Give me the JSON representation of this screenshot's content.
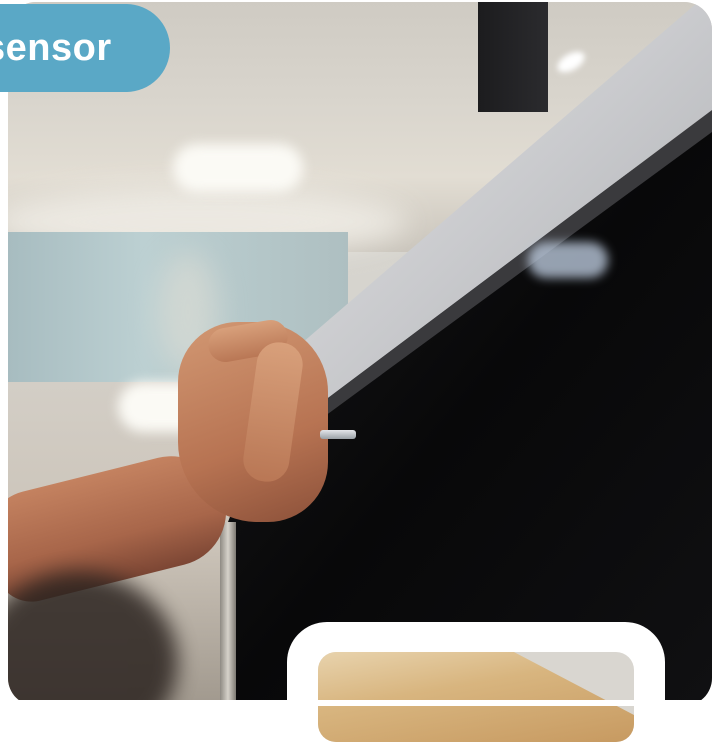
{
  "label": {
    "text": "sensor",
    "color": "#5aa8c6",
    "text_color": "#ffffff"
  },
  "photo": {
    "subject": "hand-opening-cabinet-door",
    "cabinet_color": "#0c0c0d",
    "door_edge_color": "#d8d9db",
    "skin_color": "#b77352"
  },
  "thumbnail": {
    "card_color": "#ffffff"
  }
}
